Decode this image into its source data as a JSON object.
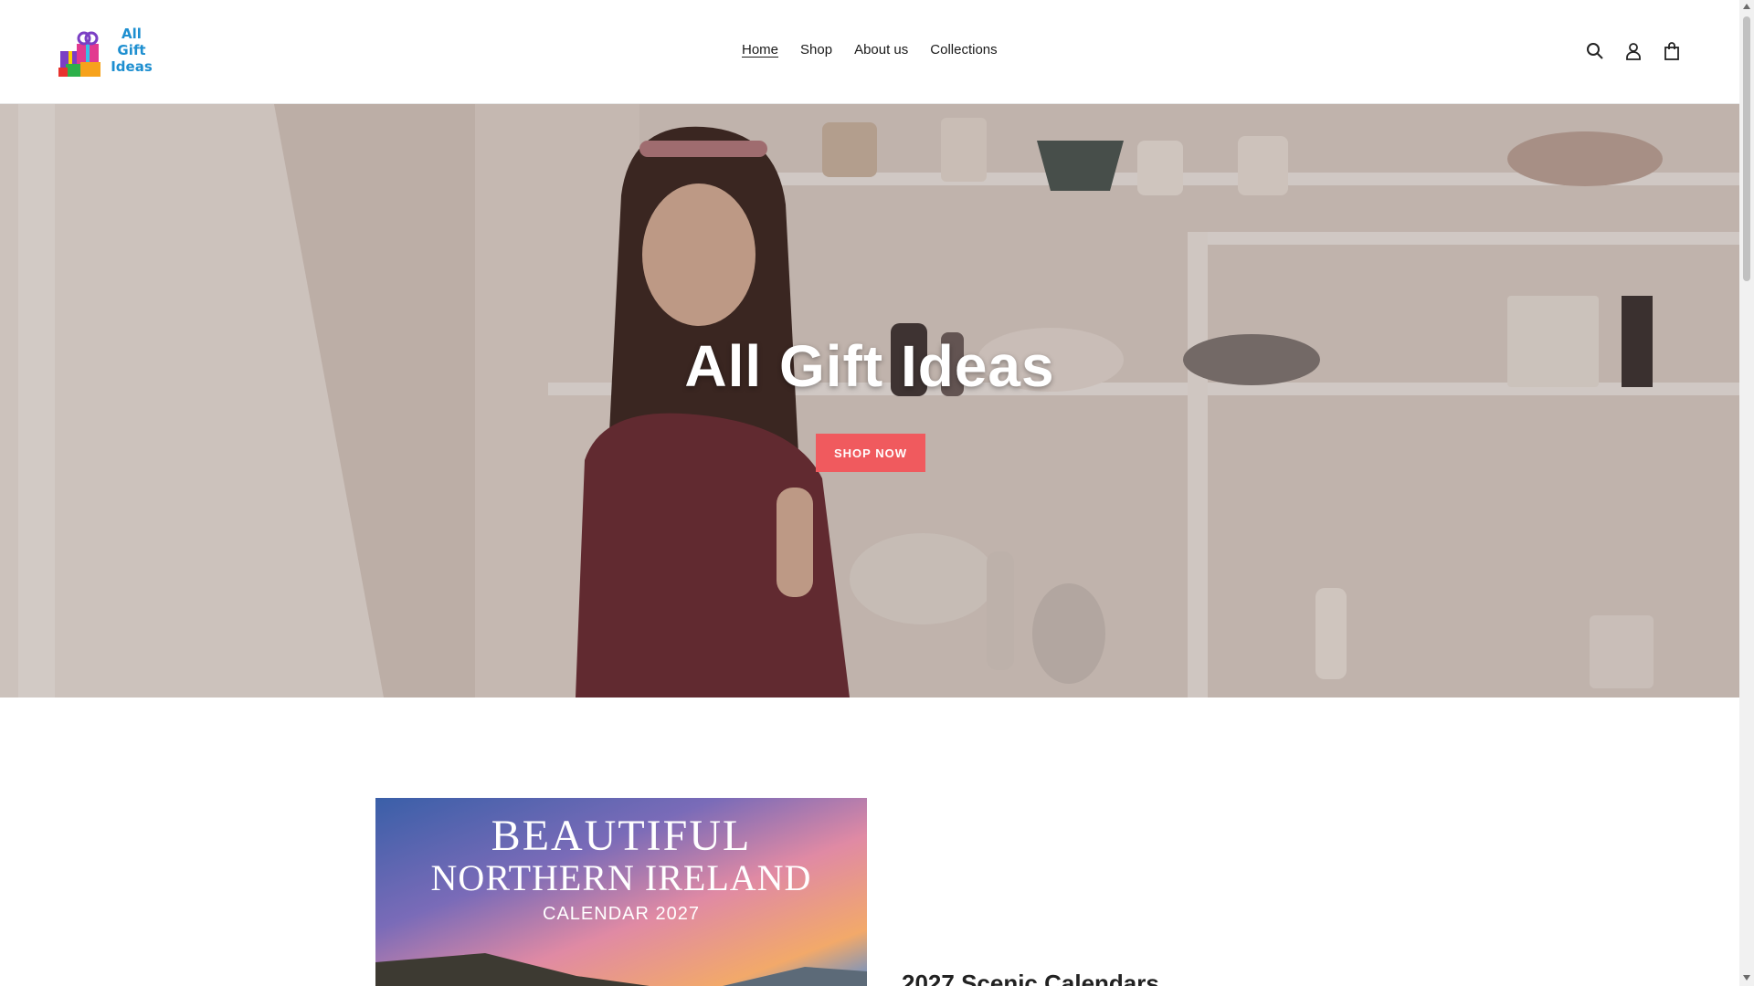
{
  "brand": {
    "logo_lines": [
      "All",
      "Gift",
      "Ideas"
    ]
  },
  "nav": {
    "items": [
      {
        "label": "Home",
        "active": true
      },
      {
        "label": "Shop",
        "active": false
      },
      {
        "label": "About us",
        "active": false
      },
      {
        "label": "Collections",
        "active": false
      }
    ]
  },
  "header_icons": [
    "search-icon",
    "account-icon",
    "cart-icon"
  ],
  "hero": {
    "title": "All Gift Ideas",
    "button_label": "SHOP NOW",
    "button_color": "#f05a5e"
  },
  "feature": {
    "image_text": {
      "line1": "BEAUTIFUL",
      "line2": "NORTHERN IRELAND",
      "line3": "CALENDAR 2027"
    },
    "heading": "2027 Scenic Calendars"
  }
}
